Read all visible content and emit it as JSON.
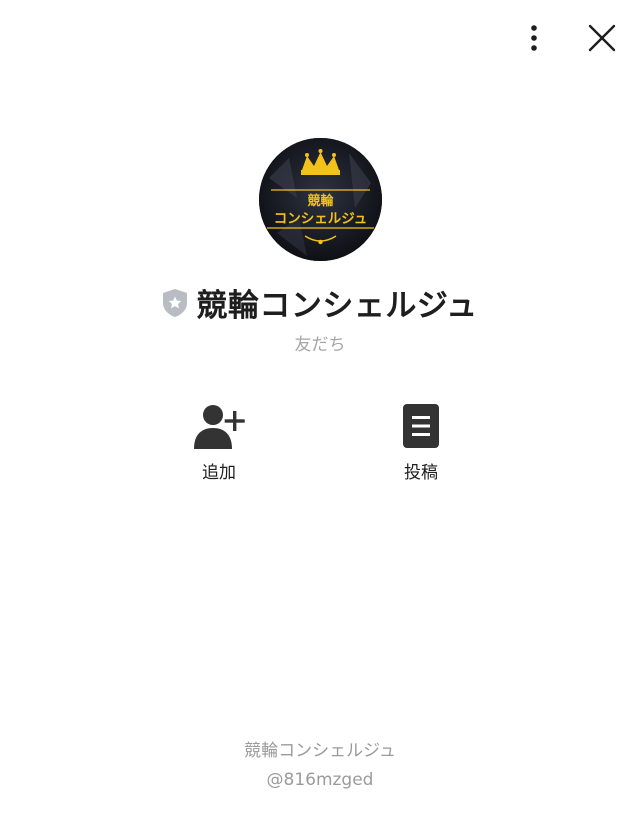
{
  "header": {
    "menu_icon": "more-vertical-icon",
    "close_icon": "close-icon"
  },
  "profile": {
    "avatar_text": "競輪\nコンシェルジュ",
    "name": "競輪コンシェルジュ",
    "badge_icon": "shield-star-icon",
    "status": "友だち"
  },
  "actions": [
    {
      "label": "追加",
      "icon": "add-friend-icon"
    },
    {
      "label": "投稿",
      "icon": "post-icon"
    }
  ],
  "footer": {
    "name": "競輪コンシェルジュ",
    "id": "@816mzged"
  },
  "colors": {
    "text": "#1e1e1e",
    "muted": "#a6a6a6",
    "gold": "#f2c21a",
    "badge": "#b9bcc3"
  }
}
